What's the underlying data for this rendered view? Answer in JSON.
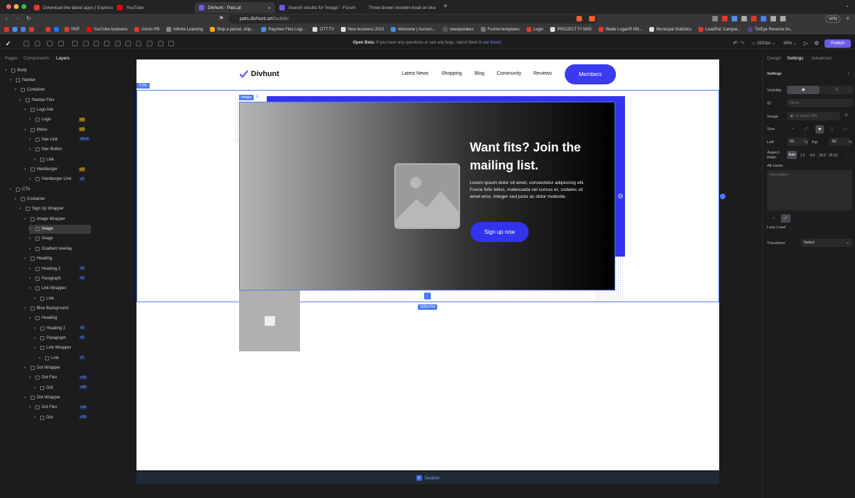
{
  "browser": {
    "tabs": [
      {
        "title": "Download the latest apps | Expresso",
        "color": "#e0392b"
      },
      {
        "title": "YouTube",
        "color": "#ff0000"
      },
      {
        "title": "Divhunt - Pats.pl",
        "color": "#6b5ce7"
      },
      {
        "title": "Search results for 'image' - Forum",
        "color": "#6b5ce7"
      },
      {
        "title": "Three brown wooden boat on blue",
        "color": "#222"
      }
    ],
    "url_host": "pats.divhunt.art",
    "url_path": "/builder",
    "vpn": "VPN",
    "bookmarks": [
      "PDF",
      "YouTube business",
      "AAron PB",
      "Infinite Learning",
      "Ship a parcel, ship...",
      "Paychex Flex Logi...",
      "OTT.TV",
      "New business 2022",
      "Welcome | Accoun...",
      "sweepstakes",
      "Funnel templates",
      "Login",
      "PROJECT FI SMS",
      "Wade Logan® Wil...",
      "Municipal Statistics",
      "LeadPal: Campai...",
      "TinEye Reverse Im..."
    ]
  },
  "toolbar": {
    "beta_label": "Open Beta:",
    "beta_text": "If you have any questions or see any bugs, report them in",
    "beta_link": "our forum.",
    "viewport": "1920px",
    "zoom": "69%",
    "publish": "Publish"
  },
  "left_panel": {
    "tabs": [
      "Pages",
      "Components",
      "Layers"
    ],
    "layers": [
      {
        "name": "Body",
        "depth": 0
      },
      {
        "name": "Navbar",
        "depth": 1
      },
      {
        "name": "Container",
        "depth": 2
      },
      {
        "name": "Navbar Flex",
        "depth": 3
      },
      {
        "name": "Logo link",
        "depth": 4
      },
      {
        "name": "Logo",
        "depth": 5,
        "badge": "x2"
      },
      {
        "name": "Menu",
        "depth": 4,
        "badge": "x2"
      },
      {
        "name": "Nav Link",
        "depth": 5,
        "badge": "x4 x2"
      },
      {
        "name": "Nav Button",
        "depth": 5
      },
      {
        "name": "Link",
        "depth": 6
      },
      {
        "name": "Hamburger",
        "depth": 4,
        "badge": "x2"
      },
      {
        "name": "Hamburger Line",
        "depth": 5,
        "badge": "x3"
      },
      {
        "name": "CTA",
        "depth": 1
      },
      {
        "name": "Container",
        "depth": 2
      },
      {
        "name": "Sign Up Wrapper",
        "depth": 3
      },
      {
        "name": "Image Wrapper",
        "depth": 4
      },
      {
        "name": "Image",
        "depth": 5,
        "selected": true
      },
      {
        "name": "Image",
        "depth": 5
      },
      {
        "name": "Gradient overlay",
        "depth": 5
      },
      {
        "name": "Heading",
        "depth": 4
      },
      {
        "name": "Heading 2",
        "depth": 5,
        "badge": "x2"
      },
      {
        "name": "Paragraph",
        "depth": 5,
        "badge": "x2"
      },
      {
        "name": "Link Wrapper",
        "depth": 5
      },
      {
        "name": "Link",
        "depth": 6
      },
      {
        "name": "Blue Background",
        "depth": 4
      },
      {
        "name": "Heading",
        "depth": 5
      },
      {
        "name": "Heading 2",
        "depth": 6,
        "badge": "x2"
      },
      {
        "name": "Paragraph",
        "depth": 6,
        "badge": "x2"
      },
      {
        "name": "Link Wrapper",
        "depth": 6
      },
      {
        "name": "Link",
        "depth": 7,
        "badge": "x1"
      },
      {
        "name": "Dot Wrapper",
        "depth": 4
      },
      {
        "name": "Dot Flex",
        "depth": 5,
        "badge": "x18"
      },
      {
        "name": "Dot",
        "depth": 6,
        "badge": "x18"
      },
      {
        "name": "Dot Wrapper",
        "depth": 4
      },
      {
        "name": "Dot Flex",
        "depth": 5,
        "badge": "x18"
      },
      {
        "name": "Dot",
        "depth": 6,
        "badge": "x18"
      }
    ]
  },
  "canvas": {
    "logo": "Divhunt",
    "nav_links": [
      "Latest News",
      "Shopping",
      "Blog",
      "Community",
      "Reviews"
    ],
    "members_button": "Members",
    "cta_label": "CTA",
    "image_label": "Image",
    "heading": "Want fits? Join the mailing list.",
    "paragraph": "Lorem ipsum dolor sit amet, consectetur adipiscing elit. Fusce felis tellus, malesuada vel cursus et, sodales sit amet eros. Integer sed justo ac dolor molestie.",
    "signup_button": "Sign up now",
    "size_badge": "1920x704",
    "section_button": "Section"
  },
  "right_panel": {
    "tabs": [
      "Design",
      "Settings",
      "Advanced"
    ],
    "title": "Settings",
    "visibility_label": "Visibility",
    "id_label": "ID",
    "id_placeholder": "None",
    "image_label": "Image",
    "image_placeholder": "or paste URL",
    "size_label": "Size",
    "left_label": "Left",
    "left_value": "50",
    "top_label": "Top",
    "top_value": "50",
    "percent": "%",
    "aspect_label": "Aspect Ratio",
    "aspect_options": [
      "Auto",
      "1:1",
      "4:3",
      "16:9",
      "16:10"
    ],
    "alt_label": "Alt name",
    "alt_placeholder": "Decoration",
    "lazy_label": "Lazy Load",
    "transform_label": "Transform",
    "transform_value": "Select"
  },
  "colors": {
    "accent": "#3333ee",
    "selection": "#4c7cf5",
    "publish": "#6b5ce7"
  }
}
